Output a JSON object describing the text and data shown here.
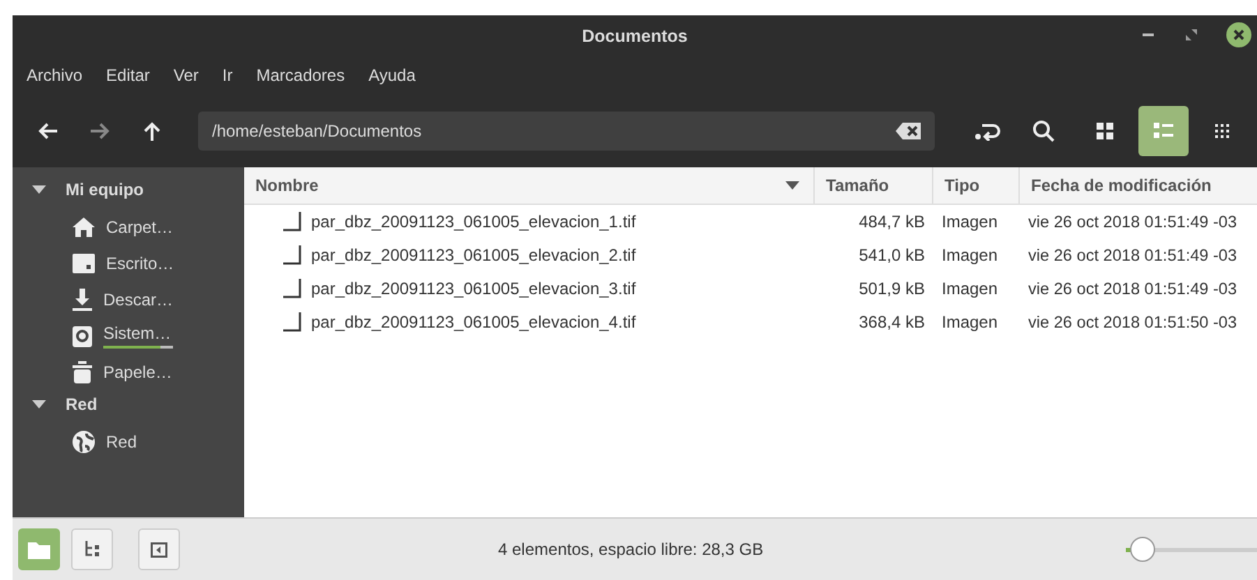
{
  "window": {
    "title": "Documentos"
  },
  "menu": [
    "Archivo",
    "Editar",
    "Ver",
    "Ir",
    "Marcadores",
    "Ayuda"
  ],
  "location": {
    "value": "/home/esteban/Documentos"
  },
  "view_modes": [
    {
      "kind": "icons",
      "selected": false
    },
    {
      "kind": "list",
      "selected": true
    },
    {
      "kind": "compact",
      "selected": false
    }
  ],
  "sidebar": [
    {
      "label": "Mi equipo",
      "expanded": true,
      "children": [
        {
          "label": "Carpet…",
          "kind": "home"
        },
        {
          "label": "Escrito…",
          "kind": "desktop"
        },
        {
          "label": "Descar…",
          "kind": "download"
        },
        {
          "label": "Sistem…",
          "kind": "drive",
          "level": 0.82
        },
        {
          "label": "Papele…",
          "kind": "trash"
        }
      ]
    },
    {
      "label": "Red",
      "expanded": true,
      "children": [
        {
          "label": "Red",
          "kind": "network"
        }
      ]
    }
  ],
  "table": {
    "columns": [
      "Nombre",
      "Tamaño",
      "Tipo",
      "Fecha de modificación"
    ],
    "rows": [
      [
        "par_dbz_20091123_061005_elevacion_1.tif",
        "484,7 kB",
        "Imagen",
        "vie 26 oct 2018 01:51:49 -03"
      ],
      [
        "par_dbz_20091123_061005_elevacion_2.tif",
        "541,0 kB",
        "Imagen",
        "vie 26 oct 2018 01:51:49 -03"
      ],
      [
        "par_dbz_20091123_061005_elevacion_3.tif",
        "501,9 kB",
        "Imagen",
        "vie 26 oct 2018 01:51:49 -03"
      ],
      [
        "par_dbz_20091123_061005_elevacion_4.tif",
        "368,4 kB",
        "Imagen",
        "vie 26 oct 2018 01:51:50 -03"
      ]
    ]
  },
  "status_bar": {
    "sidebar_mode": [
      {
        "kind": "places",
        "selected": true
      },
      {
        "kind": "tree",
        "selected": false
      }
    ],
    "text": "4 elementos, espacio libre: 28,3 GB",
    "zoom": {
      "level": 0.12
    }
  }
}
